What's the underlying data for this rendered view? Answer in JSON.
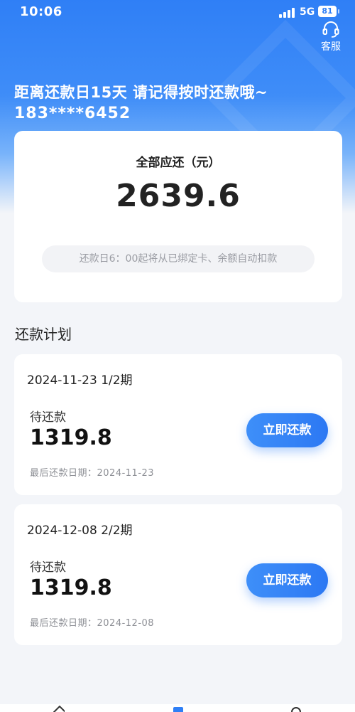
{
  "status_bar": {
    "time": "10:06",
    "network": "5G",
    "battery": "81"
  },
  "header": {
    "service_label": "客服",
    "due_notice": "距离还款日15天 请记得按时还款哦~",
    "phone": "183****6452"
  },
  "summary": {
    "label": "全部应还（元）",
    "amount": "2639.6",
    "auto_debit_note": "还款日6：00起将从已绑定卡、余额自动扣款"
  },
  "plan": {
    "title": "还款计划",
    "installments": [
      {
        "period": "2024-11-23 1/2期",
        "status": "待还款",
        "amount": "1319.8",
        "deadline": "最后还款日期：2024-11-23",
        "button": "立即还款"
      },
      {
        "period": "2024-12-08 2/2期",
        "status": "待还款",
        "amount": "1319.8",
        "deadline": "最后还款日期：2024-12-08",
        "button": "立即还款"
      }
    ]
  },
  "icons": {
    "signal": "signal-icon",
    "battery": "battery-icon",
    "service": "headset-icon",
    "tabs": [
      "home-icon",
      "bill-icon",
      "profile-icon"
    ]
  },
  "colors": {
    "accent": "#2f7ff6",
    "background": "#f3f5f9"
  }
}
